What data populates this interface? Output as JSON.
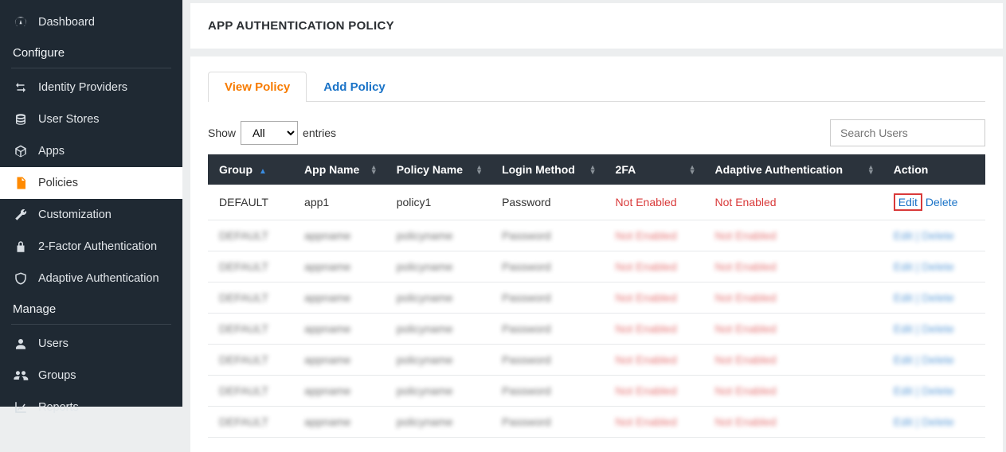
{
  "sidebar": {
    "items_top": [
      {
        "label": "Dashboard",
        "icon": "dashboard"
      }
    ],
    "sections": [
      {
        "header": "Configure",
        "items": [
          {
            "label": "Identity Providers",
            "icon": "arrows"
          },
          {
            "label": "User Stores",
            "icon": "database"
          },
          {
            "label": "Apps",
            "icon": "box"
          },
          {
            "label": "Policies",
            "icon": "document",
            "active": true
          },
          {
            "label": "Customization",
            "icon": "wrench"
          },
          {
            "label": "2-Factor Authentication",
            "icon": "lock"
          },
          {
            "label": "Adaptive Authentication",
            "icon": "shield"
          }
        ]
      },
      {
        "header": "Manage",
        "items": [
          {
            "label": "Users",
            "icon": "user"
          },
          {
            "label": "Groups",
            "icon": "users"
          },
          {
            "label": "Reports",
            "icon": "chart"
          }
        ]
      }
    ]
  },
  "page": {
    "title": "APP AUTHENTICATION POLICY"
  },
  "tabs": [
    {
      "label": "View Policy",
      "active": true
    },
    {
      "label": "Add Policy",
      "active": false
    }
  ],
  "toolbar": {
    "show_label": "Show",
    "entries_label": "entries",
    "select_value": "All",
    "select_options": [
      "All"
    ],
    "search_placeholder": "Search Users"
  },
  "table": {
    "columns": [
      {
        "key": "group",
        "label": "Group",
        "sorted_asc": true
      },
      {
        "key": "app_name",
        "label": "App Name"
      },
      {
        "key": "policy_name",
        "label": "Policy Name"
      },
      {
        "key": "login_method",
        "label": "Login Method"
      },
      {
        "key": "two_fa",
        "label": "2FA"
      },
      {
        "key": "adaptive_auth",
        "label": "Adaptive Authentication"
      },
      {
        "key": "action",
        "label": "Action"
      }
    ],
    "rows": [
      {
        "group": "DEFAULT",
        "app_name": "app1",
        "policy_name": "policy1",
        "login_method": "Password",
        "two_fa": "Not Enabled",
        "adaptive_auth": "Not Enabled",
        "actions": {
          "edit": "Edit",
          "delete": "Delete"
        },
        "highlight_edit": true
      }
    ],
    "blurred_rows": 7
  }
}
